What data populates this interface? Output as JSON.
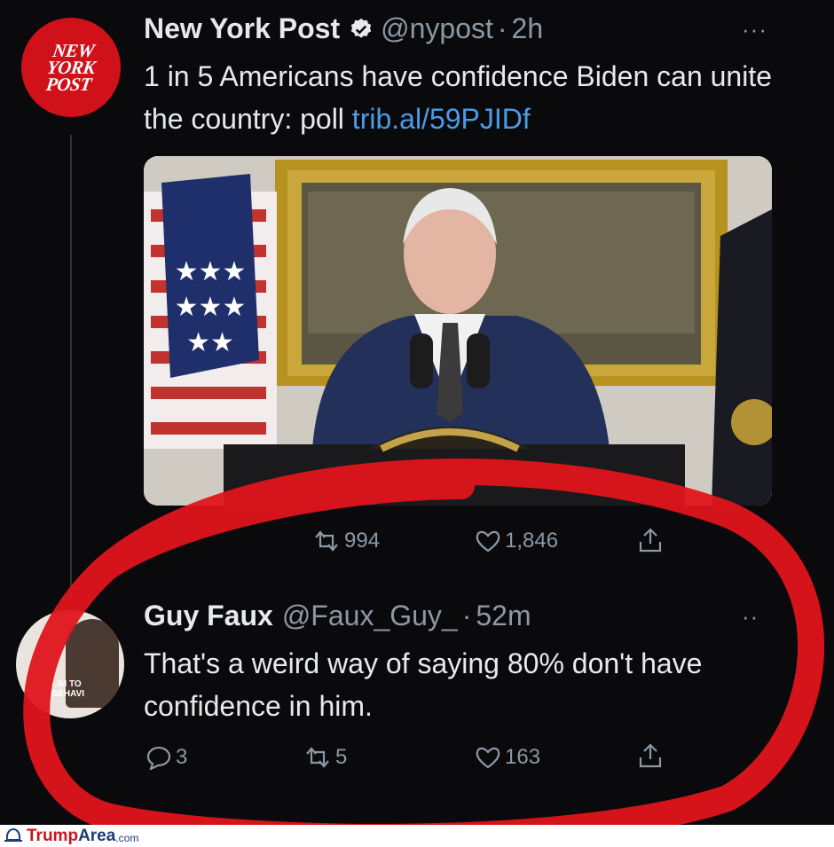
{
  "tweet1": {
    "avatar_text": [
      "NEW",
      "YORK",
      "POST"
    ],
    "name": "New York Post",
    "handle": "@nypost",
    "separator": "·",
    "time": "2h",
    "text": "1 in 5 Americans have confidence Biden can unite the country: poll ",
    "link": "trib.al/59PJIDf",
    "retweets": "994",
    "likes": "1,846"
  },
  "tweet2": {
    "avatar_caption": [
      "LIM TO",
      "BEHAVI"
    ],
    "name": "Guy Faux",
    "handle": "@Faux_Guy_",
    "separator": "·",
    "time": "52m",
    "text": "That's a weird way of saying 80% don't have confidence in him.",
    "replies": "3",
    "retweets": "5",
    "likes": "163"
  },
  "watermark": {
    "brand_part1": "Trump",
    "brand_part2": "Area",
    "brand_part3": ".com"
  },
  "colors": {
    "background": "#0a0a0c",
    "text": "#e7e9ea",
    "muted": "#8b98a5",
    "link": "#4a9ce8",
    "nyp_red": "#d1111a",
    "annotation_red": "#e0141b"
  }
}
